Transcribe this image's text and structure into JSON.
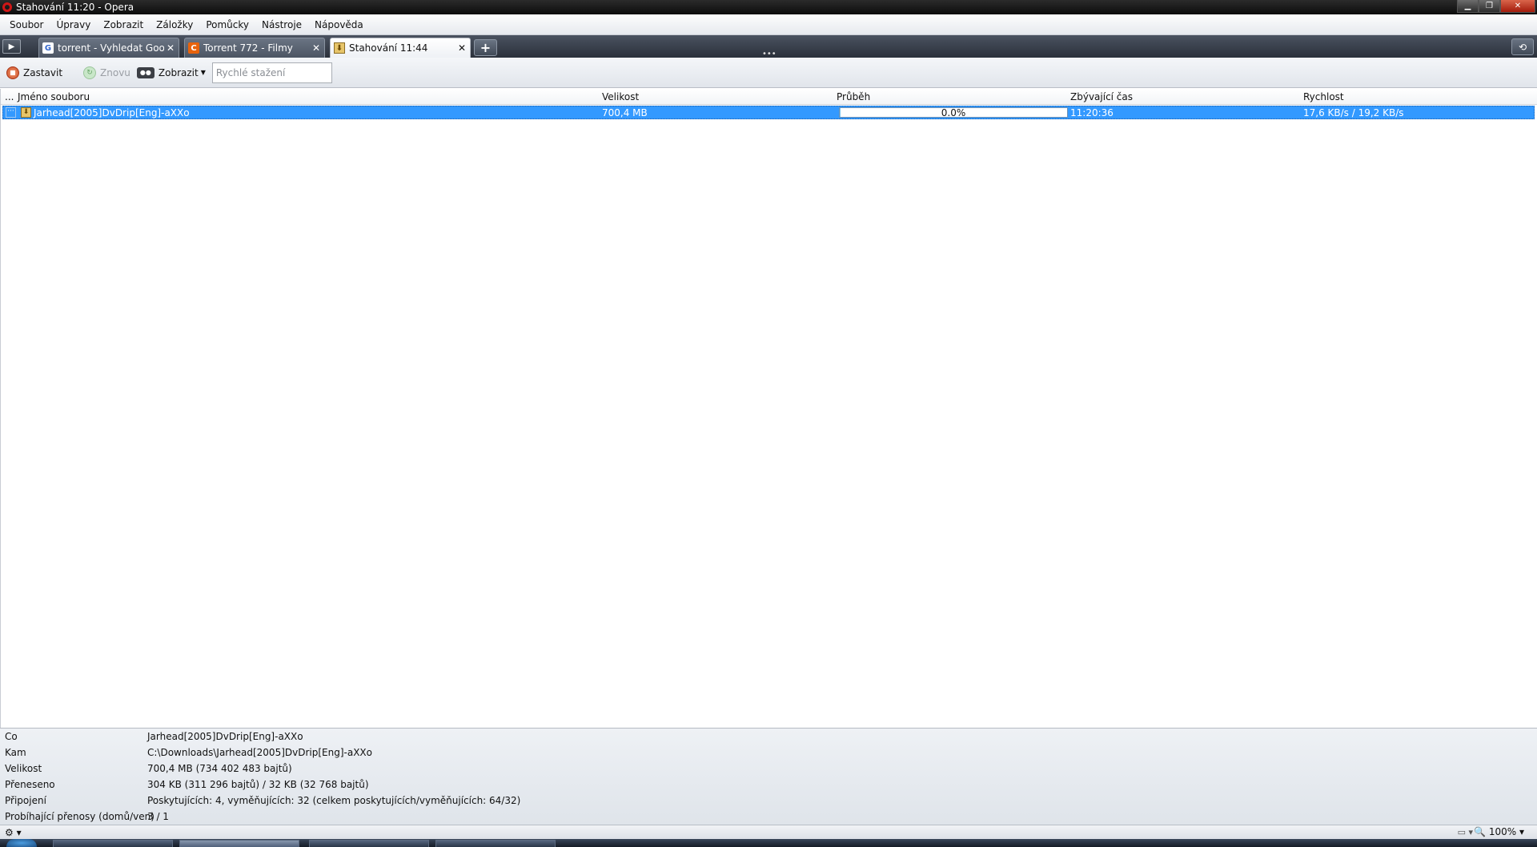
{
  "window": {
    "title": "Stahování 11:20 - Opera",
    "minimize": "▁",
    "maximize": "❐",
    "close": "✕"
  },
  "menu": [
    "Soubor",
    "Úpravy",
    "Zobrazit",
    "Záložky",
    "Pomůcky",
    "Nástroje",
    "Nápověda"
  ],
  "tabs": [
    {
      "label": "torrent - Vyhledat Goo...",
      "icon": "google-icon",
      "active": false
    },
    {
      "label": "Torrent 772 - Filmy",
      "icon": "torrent-site-icon",
      "active": false
    },
    {
      "label": "Stahování 11:44",
      "icon": "download-icon",
      "active": true
    }
  ],
  "tabbar": {
    "new_tab": "+",
    "close_glyph": "✕",
    "closed_tabs_glyph": "⟲",
    "panel_glyph": "▶"
  },
  "toolbar": {
    "stop_label": "Zastavit",
    "retry_label": "Znovu",
    "view_label": "Zobrazit",
    "quick_search_placeholder": "Rychlé stažení"
  },
  "table": {
    "columns": [
      "...",
      "Jméno souboru",
      "Velikost",
      "Průběh",
      "Zbývající čas",
      "Rychlost"
    ],
    "rows": [
      {
        "name": "Jarhead[2005]DvDrip[Eng]-aXXo",
        "size": "700,4 MB",
        "progress_text": "0.0%",
        "progress_fraction": 0.004,
        "remaining": "11:20:36",
        "speed": "17,6 KB/s / 19,2 KB/s"
      }
    ]
  },
  "details": [
    {
      "key": "Co",
      "value": "Jarhead[2005]DvDrip[Eng]-aXXo"
    },
    {
      "key": "Kam",
      "value": "C:\\Downloads\\Jarhead[2005]DvDrip[Eng]-aXXo"
    },
    {
      "key": "Velikost",
      "value": "700,4 MB (734 402 483 bajtů)"
    },
    {
      "key": "Přeneseno",
      "value": "304 KB (311 296 bajtů) / 32 KB (32 768 bajtů)"
    },
    {
      "key": "Připojení",
      "value": "Poskytujících: 4, vyměňujících: 32 (celkem poskytujících/vyměňujících: 64/32)"
    },
    {
      "key": "Probíhající přenosy (domů/ven)",
      "value": "3 / 1"
    }
  ],
  "statusbar": {
    "zoom": "100%",
    "zoom_glyph": "🔍"
  },
  "colors": {
    "selection": "#3399ff",
    "progress": "#7cc6f2",
    "accent_opera": "#d01616"
  }
}
